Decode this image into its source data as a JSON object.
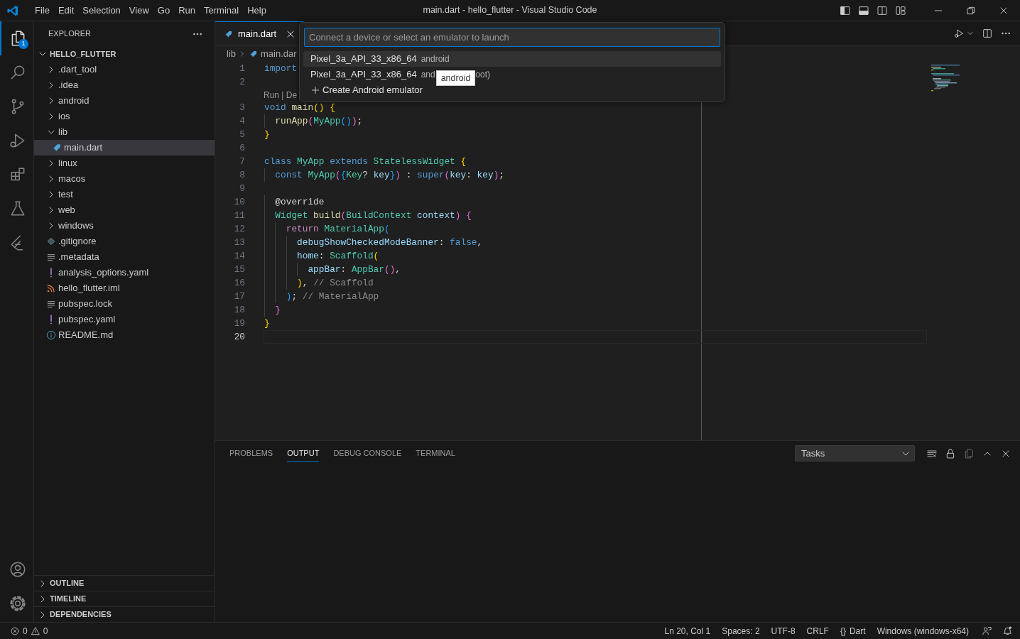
{
  "title_bar": {
    "menu": [
      "File",
      "Edit",
      "Selection",
      "View",
      "Go",
      "Run",
      "Terminal",
      "Help"
    ],
    "title": "main.dart - hello_flutter - Visual Studio Code"
  },
  "activity_bar": {
    "top": [
      {
        "kind": "files",
        "selected": true,
        "badge": "1"
      },
      {
        "kind": "search",
        "selected": false
      },
      {
        "kind": "source-control",
        "selected": false
      },
      {
        "kind": "run-debug",
        "selected": false
      },
      {
        "kind": "extensions",
        "selected": false
      },
      {
        "kind": "testing",
        "selected": false
      },
      {
        "kind": "flutter",
        "selected": false
      }
    ],
    "bottom": [
      {
        "kind": "account"
      },
      {
        "kind": "settings"
      }
    ]
  },
  "sidebar": {
    "title": "EXPLORER",
    "root": {
      "label": "HELLO_FLUTTER",
      "expanded": true
    },
    "tree": [
      {
        "kind": "folder",
        "label": ".dart_tool",
        "expanded": false,
        "selected": false
      },
      {
        "kind": "folder",
        "label": ".idea",
        "expanded": false,
        "selected": false
      },
      {
        "kind": "folder",
        "label": "android",
        "expanded": false,
        "selected": false
      },
      {
        "kind": "folder",
        "label": "ios",
        "expanded": false,
        "selected": false
      },
      {
        "kind": "folder",
        "label": "lib",
        "expanded": true,
        "selected": false,
        "children": [
          {
            "kind": "dart",
            "label": "main.dart",
            "selected": true
          }
        ]
      },
      {
        "kind": "folder",
        "label": "linux",
        "expanded": false,
        "selected": false
      },
      {
        "kind": "folder",
        "label": "macos",
        "expanded": false,
        "selected": false
      },
      {
        "kind": "folder",
        "label": "test",
        "expanded": false,
        "selected": false
      },
      {
        "kind": "folder",
        "label": "web",
        "expanded": false,
        "selected": false
      },
      {
        "kind": "folder",
        "label": "windows",
        "expanded": false,
        "selected": false
      },
      {
        "kind": "git",
        "label": ".gitignore",
        "selected": false
      },
      {
        "kind": "lines",
        "label": ".metadata",
        "selected": false
      },
      {
        "kind": "yaml",
        "label": "analysis_options.yaml",
        "selected": false
      },
      {
        "kind": "feed",
        "label": "hello_flutter.iml",
        "selected": false
      },
      {
        "kind": "lines",
        "label": "pubspec.lock",
        "selected": false
      },
      {
        "kind": "yaml",
        "label": "pubspec.yaml",
        "selected": false
      },
      {
        "kind": "info",
        "label": "README.md",
        "selected": false
      }
    ],
    "sections": [
      {
        "label": "OUTLINE",
        "expanded": false
      },
      {
        "label": "TIMELINE",
        "expanded": false
      },
      {
        "label": "DEPENDENCIES",
        "expanded": false
      }
    ]
  },
  "editor": {
    "tabs": [
      {
        "label": "main.dart",
        "selected": true
      }
    ],
    "breadcrumbs": [
      "lib",
      "main.dar"
    ],
    "lines": [
      {
        "number": "1",
        "current": false,
        "tokens": [
          {
            "text": "import",
            "kind": "keyword"
          }
        ]
      },
      {
        "number": "2",
        "current": false
      },
      {
        "number": "3",
        "current": false,
        "codelens": "Run | De",
        "tokens": [
          {
            "text": "void",
            "kind": "keyword"
          },
          {
            "text": " main",
            "kind": "function"
          },
          {
            "text": "()",
            "kind": "bracket1"
          },
          {
            "text": " {",
            "kind": "bracket1"
          }
        ]
      },
      {
        "number": "4",
        "current": false,
        "tokens": [
          {
            "text": "  runApp",
            "kind": "function"
          },
          {
            "text": "(",
            "kind": "bracket2"
          },
          {
            "text": "MyApp",
            "kind": "type"
          },
          {
            "text": "()",
            "kind": "bracket3"
          },
          {
            "text": ")",
            "kind": "bracket2"
          },
          {
            "text": ";",
            "kind": "plain"
          }
        ]
      },
      {
        "number": "5",
        "current": false,
        "tokens": [
          {
            "text": "}",
            "kind": "bracket1"
          }
        ]
      },
      {
        "number": "6",
        "current": false
      },
      {
        "number": "7",
        "current": false,
        "tokens": [
          {
            "text": "class",
            "kind": "keyword"
          },
          {
            "text": " MyApp",
            "kind": "type"
          },
          {
            "text": " extends",
            "kind": "keyword"
          },
          {
            "text": " StatelessWidget",
            "kind": "type"
          },
          {
            "text": " {",
            "kind": "bracket1"
          }
        ]
      },
      {
        "number": "8",
        "current": false,
        "tokens": [
          {
            "text": "  const",
            "kind": "keyword"
          },
          {
            "text": " MyApp",
            "kind": "type"
          },
          {
            "text": "(",
            "kind": "bracket2"
          },
          {
            "text": "{",
            "kind": "bracket3"
          },
          {
            "text": "Key",
            "kind": "type"
          },
          {
            "text": "?",
            "kind": "plain"
          },
          {
            "text": " key",
            "kind": "variable"
          },
          {
            "text": "}",
            "kind": "bracket3"
          },
          {
            "text": ")",
            "kind": "bracket2"
          },
          {
            "text": " : ",
            "kind": "plain"
          },
          {
            "text": "super",
            "kind": "keyword"
          },
          {
            "text": "(",
            "kind": "bracket2"
          },
          {
            "text": "key",
            "kind": "variable"
          },
          {
            "text": ": ",
            "kind": "plain"
          },
          {
            "text": "key",
            "kind": "variable"
          },
          {
            "text": ")",
            "kind": "bracket2"
          },
          {
            "text": ";",
            "kind": "plain"
          }
        ]
      },
      {
        "number": "9",
        "current": false
      },
      {
        "number": "10",
        "current": false,
        "tokens": [
          {
            "text": "  @override",
            "kind": "plain"
          }
        ]
      },
      {
        "number": "11",
        "current": false,
        "tokens": [
          {
            "text": "  Widget",
            "kind": "type"
          },
          {
            "text": " build",
            "kind": "function"
          },
          {
            "text": "(",
            "kind": "bracket2"
          },
          {
            "text": "BuildContext",
            "kind": "type"
          },
          {
            "text": " context",
            "kind": "variable"
          },
          {
            "text": ")",
            "kind": "bracket2"
          },
          {
            "text": " {",
            "kind": "bracket2"
          }
        ]
      },
      {
        "number": "12",
        "current": false,
        "tokens": [
          {
            "text": "    return",
            "kind": "control"
          },
          {
            "text": " MaterialApp",
            "kind": "type"
          },
          {
            "text": "(",
            "kind": "bracket3"
          }
        ]
      },
      {
        "number": "13",
        "current": false,
        "tokens": [
          {
            "text": "      debugShowCheckedModeBanner",
            "kind": "variable"
          },
          {
            "text": ": ",
            "kind": "plain"
          },
          {
            "text": "false",
            "kind": "keyword"
          },
          {
            "text": ",",
            "kind": "plain"
          }
        ]
      },
      {
        "number": "14",
        "current": false,
        "tokens": [
          {
            "text": "      home",
            "kind": "variable"
          },
          {
            "text": ": ",
            "kind": "plain"
          },
          {
            "text": "Scaffold",
            "kind": "type"
          },
          {
            "text": "(",
            "kind": "bracket1"
          }
        ]
      },
      {
        "number": "15",
        "current": false,
        "tokens": [
          {
            "text": "        appBar",
            "kind": "variable"
          },
          {
            "text": ": ",
            "kind": "plain"
          },
          {
            "text": "AppBar",
            "kind": "type"
          },
          {
            "text": "()",
            "kind": "bracket2"
          },
          {
            "text": ",",
            "kind": "plain"
          }
        ]
      },
      {
        "number": "16",
        "current": false,
        "tokens": [
          {
            "text": "      )",
            "kind": "bracket1"
          },
          {
            "text": ", ",
            "kind": "plain"
          },
          {
            "text": "// Scaffold",
            "kind": "comment"
          }
        ]
      },
      {
        "number": "17",
        "current": false,
        "tokens": [
          {
            "text": "    )",
            "kind": "bracket3"
          },
          {
            "text": "; ",
            "kind": "plain"
          },
          {
            "text": "// MaterialApp",
            "kind": "comment"
          }
        ]
      },
      {
        "number": "18",
        "current": false,
        "tokens": [
          {
            "text": "  }",
            "kind": "bracket2"
          }
        ]
      },
      {
        "number": "19",
        "current": false,
        "tokens": [
          {
            "text": "}",
            "kind": "bracket1"
          }
        ]
      },
      {
        "number": "20",
        "current": true
      }
    ]
  },
  "quick_pick": {
    "placeholder": "Connect a device or select an emulator to launch",
    "items": [
      {
        "kind": "device",
        "label": "Pixel_3a_API_33_x86_64",
        "detail": "android",
        "selected": true
      },
      {
        "kind": "device",
        "label": "Pixel_3a_API_33_x86_64",
        "detail": "and",
        "tooltip": "android",
        "detail_end": "oot)",
        "selected": false
      },
      {
        "kind": "action",
        "label": "Create Android emulator",
        "selected": false
      }
    ]
  },
  "panel": {
    "tabs": [
      {
        "label": "PROBLEMS",
        "selected": false
      },
      {
        "label": "OUTPUT",
        "selected": true
      },
      {
        "label": "DEBUG CONSOLE",
        "selected": false
      },
      {
        "label": "TERMINAL",
        "selected": false
      }
    ],
    "dropdown": "Tasks"
  },
  "status_bar": {
    "errors": "0",
    "warnings": "0",
    "items": [
      {
        "label": "Ln 20, Col 1"
      },
      {
        "label": "Spaces: 2"
      },
      {
        "label": "UTF-8"
      },
      {
        "label": "CRLF"
      },
      {
        "glyph": "{}",
        "label": "Dart"
      },
      {
        "label": "Windows (windows-x64)"
      }
    ]
  }
}
